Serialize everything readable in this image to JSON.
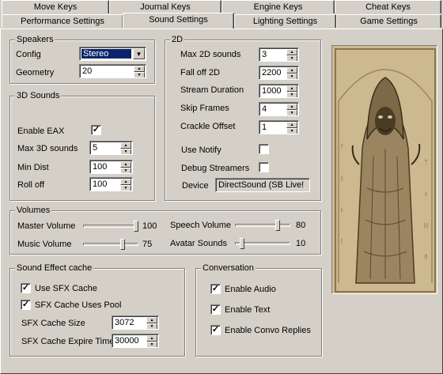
{
  "tabs": {
    "row1": [
      "Move Keys",
      "Journal Keys",
      "Engine Keys",
      "Cheat Keys"
    ],
    "row2": [
      "Performance Settings",
      "Sound Settings",
      "Lighting Settings",
      "Game Settings"
    ],
    "active": "Sound Settings"
  },
  "speakers": {
    "title": "Speakers",
    "config_label": "Config",
    "config_value": "Stereo",
    "geometry_label": "Geometry",
    "geometry_value": "20"
  },
  "sounds3d": {
    "title": "3D Sounds",
    "enable_eax_label": "Enable EAX",
    "enable_eax": true,
    "max_label": "Max 3D sounds",
    "max_value": "5",
    "min_dist_label": "Min Dist",
    "min_dist_value": "100",
    "rolloff_label": "Roll off",
    "rolloff_value": "100"
  },
  "twod": {
    "title": "2D",
    "max_label": "Max 2D sounds",
    "max_value": "3",
    "falloff_label": "Fall off 2D",
    "falloff_value": "2200",
    "stream_label": "Stream Duration",
    "stream_value": "1000",
    "skip_label": "Skip Frames",
    "skip_value": "4",
    "crackle_label": "Crackle Offset",
    "crackle_value": "1",
    "use_notify_label": "Use Notify",
    "use_notify": false,
    "debug_label": "Debug Streamers",
    "debug": false,
    "device_label": "Device",
    "device_value": "DirectSound (SB Live!"
  },
  "volumes": {
    "title": "Volumes",
    "master_label": "Master Volume",
    "master_value": "100",
    "music_label": "Music Volume",
    "music_value": "75",
    "speech_label": "Speech Volume",
    "speech_value": "80",
    "avatar_label": "Avatar Sounds",
    "avatar_value": "10"
  },
  "sfx": {
    "title": "Sound Effect cache",
    "use_label": "Use SFX Cache",
    "use": true,
    "pool_label": "SFX Cache Uses Pool",
    "pool": true,
    "size_label": "SFX Cache Size",
    "size_value": "3072",
    "expire_label": "SFX Cache Expire Time",
    "expire_value": "30000"
  },
  "conversation": {
    "title": "Conversation",
    "audio_label": "Enable Audio",
    "audio": true,
    "text_label": "Enable Text",
    "text": true,
    "replies_label": "Enable Convo Replies",
    "replies": true
  },
  "colors": {
    "face": "#d4d0c8",
    "selection": "#0a246a",
    "parchment": "#cbb893"
  }
}
